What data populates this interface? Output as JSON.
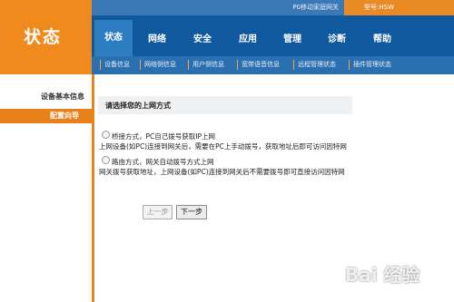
{
  "header": {
    "logo_text": "状态",
    "top_strip_text": "P0移动家庭网关",
    "model_text": "型号:HSW"
  },
  "nav": {
    "tabs": [
      {
        "label": "状态",
        "active": true
      },
      {
        "label": "网络",
        "active": false
      },
      {
        "label": "安全",
        "active": false
      },
      {
        "label": "应用",
        "active": false
      },
      {
        "label": "管理",
        "active": false
      },
      {
        "label": "诊断",
        "active": false
      },
      {
        "label": "帮助",
        "active": false
      }
    ]
  },
  "sub_nav": {
    "items": [
      "设备信息",
      "网络侧信息",
      "用户侧信息",
      "宽带语音信息",
      "远程管理状态",
      "插件管理状态"
    ]
  },
  "sidebar": {
    "items": [
      {
        "label": "设备基本信息"
      },
      {
        "label": "配置向导"
      }
    ]
  },
  "content": {
    "title": "请选择您的上网方式",
    "option_bridge": "桥接方式，PC自己拨号获取IP上网",
    "option_bridge_desc": "上网设备(如PC)连接到网关后，需要在PC上手动拨号，获取地址后即可访问因特网",
    "option_route": "路由方式，网关自动拨号方式上网",
    "option_route_desc": "网关拨号获取地址，上网设备(如PC)连接到网关后不需要拨号即可直接访问因特网"
  },
  "buttons": {
    "prev": "上一步",
    "next": "下一步"
  },
  "watermark": {
    "text": "Bai 经验"
  },
  "colors": {
    "orange": "#f08a1c",
    "blue": "#11599e",
    "active_tab": "#2d7dc3"
  }
}
